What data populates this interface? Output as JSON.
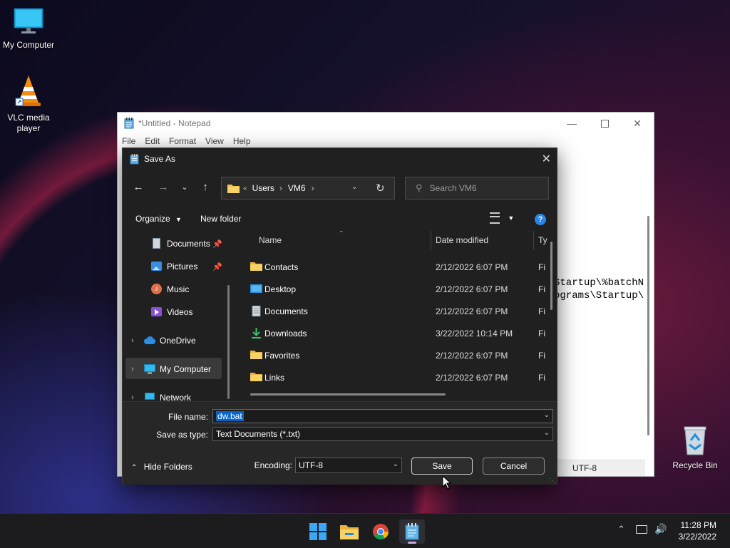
{
  "desktop": {
    "icons": [
      {
        "label": "My Computer"
      },
      {
        "label": "VLC media player"
      },
      {
        "label": "Recycle Bin"
      }
    ]
  },
  "notepad": {
    "title": "*Untitled - Notepad",
    "menu": [
      "File",
      "Edit",
      "Format",
      "View",
      "Help"
    ],
    "text_line1": "Startup\\%batchN",
    "text_line2": "ograms\\Startup\\",
    "status_encoding": "UTF-8"
  },
  "dialog": {
    "title": "Save As",
    "address": {
      "prefix": "«",
      "crumbs": [
        "Users",
        "VM6"
      ]
    },
    "search_placeholder": "Search VM6",
    "toolbar": {
      "organize": "Organize",
      "new_folder": "New folder"
    },
    "nav": [
      {
        "label": "Documents",
        "icon": "document-icon",
        "pinned": true
      },
      {
        "label": "Pictures",
        "icon": "pictures-icon",
        "pinned": true
      },
      {
        "label": "Music",
        "icon": "music-icon",
        "pinned": false
      },
      {
        "label": "Videos",
        "icon": "videos-icon",
        "pinned": false
      },
      {
        "label": "OneDrive",
        "icon": "cloud-icon",
        "pinned": false
      },
      {
        "label": "My Computer",
        "icon": "monitor-icon",
        "pinned": false
      },
      {
        "label": "Network",
        "icon": "network-icon",
        "pinned": false
      }
    ],
    "columns": {
      "name": "Name",
      "date": "Date modified",
      "type": "Ty"
    },
    "files": [
      {
        "name": "Contacts",
        "date": "2/12/2022 6:07 PM",
        "type": "Fi",
        "icon": "folder-icon"
      },
      {
        "name": "Desktop",
        "date": "2/12/2022 6:07 PM",
        "type": "Fi",
        "icon": "desktop-folder-icon"
      },
      {
        "name": "Documents",
        "date": "2/12/2022 6:07 PM",
        "type": "Fi",
        "icon": "document-icon"
      },
      {
        "name": "Downloads",
        "date": "3/22/2022 10:14 PM",
        "type": "Fi",
        "icon": "download-icon"
      },
      {
        "name": "Favorites",
        "date": "2/12/2022 6:07 PM",
        "type": "Fi",
        "icon": "folder-icon"
      },
      {
        "name": "Links",
        "date": "2/12/2022 6:07 PM",
        "type": "Fi",
        "icon": "folder-icon"
      }
    ],
    "form": {
      "file_name_label": "File name:",
      "file_name_value": "dw.bat",
      "save_as_type_label": "Save as type:",
      "save_as_type_value": "Text Documents (*.txt)",
      "hide_folders": "Hide Folders",
      "encoding_label": "Encoding:",
      "encoding_value": "UTF-8",
      "save": "Save",
      "cancel": "Cancel"
    }
  },
  "taskbar": {
    "time": "11:28 PM",
    "date": "3/22/2022"
  },
  "colors": {
    "accent": "#0078d4",
    "folder": "#f2c14e",
    "selection": "#0a64c8"
  }
}
